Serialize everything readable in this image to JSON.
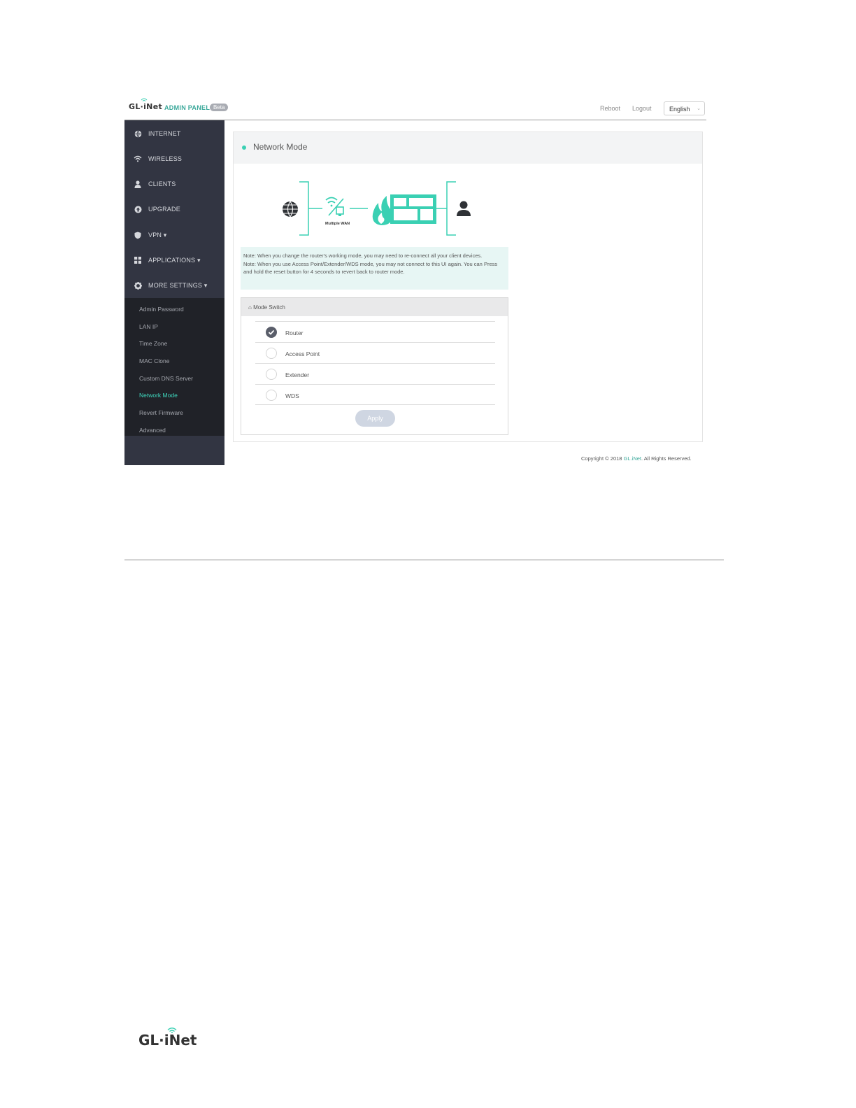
{
  "header": {
    "brand": "GL·iNet",
    "panel_label": "ADMIN PANEL",
    "badge": "Beta",
    "reboot": "Reboot",
    "logout": "Logout",
    "language": "English"
  },
  "sidebar": {
    "items": [
      {
        "label": "INTERNET",
        "icon": "globe-icon"
      },
      {
        "label": "WIRELESS",
        "icon": "wifi-icon"
      },
      {
        "label": "CLIENTS",
        "icon": "user-icon"
      },
      {
        "label": "UPGRADE",
        "icon": "upload-icon"
      },
      {
        "label": "VPN ▾",
        "icon": "shield-icon"
      },
      {
        "label": "APPLICATIONS ▾",
        "icon": "grid-icon"
      },
      {
        "label": "MORE SETTINGS ▾",
        "icon": "gear-icon"
      }
    ],
    "subitems": [
      "Admin Password",
      "LAN IP",
      "Time Zone",
      "MAC Clone",
      "Custom DNS Server",
      "Network Mode",
      "Revert Firmware",
      "Advanced"
    ],
    "active_subitem": "Network Mode"
  },
  "main": {
    "title": "Network Mode",
    "diagram_label": "Multiple WAN",
    "note_line1": "Note: When you change the router's working mode, you may need to re-connect all your client devices.",
    "note_line2": "Note: When you use Access Point/Extender/WDS mode, you may not connect to this UI again. You can Press and hold the reset button for 4 seconds to revert back to router mode.",
    "panel_title": "Mode Switch",
    "modes": [
      "Router",
      "Access Point",
      "Extender",
      "WDS"
    ],
    "selected_mode": "Router",
    "apply": "Apply"
  },
  "footer": {
    "copyright_prefix": "Copyright © 2018 ",
    "copyright_brand": "GL.iNet",
    "copyright_suffix": ". All Rights Reserved."
  },
  "page_footer": {
    "logo": "GL·iNet"
  },
  "colors": {
    "accent": "#3ad0b3",
    "sidebar_bg": "#323542",
    "submenu_bg": "#202228",
    "active_text": "#3fd9bf"
  }
}
